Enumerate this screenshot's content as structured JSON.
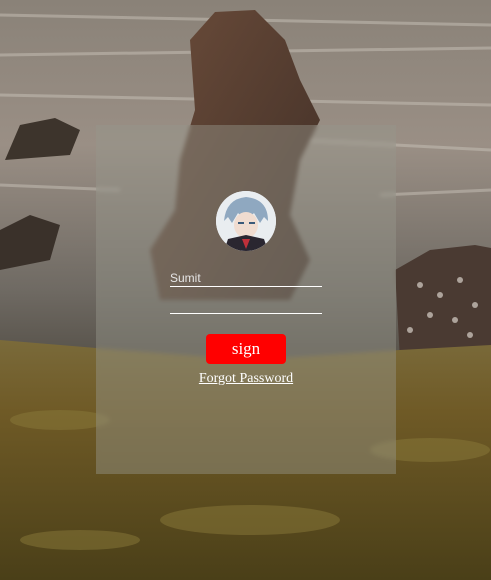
{
  "login": {
    "username_placeholder": "Sumit",
    "password_placeholder": "",
    "sign_label": "sign",
    "forgot_label": "Forgot Password"
  },
  "colors": {
    "button": "#ff0000",
    "card": "#96968c",
    "text": "#ffffff"
  }
}
